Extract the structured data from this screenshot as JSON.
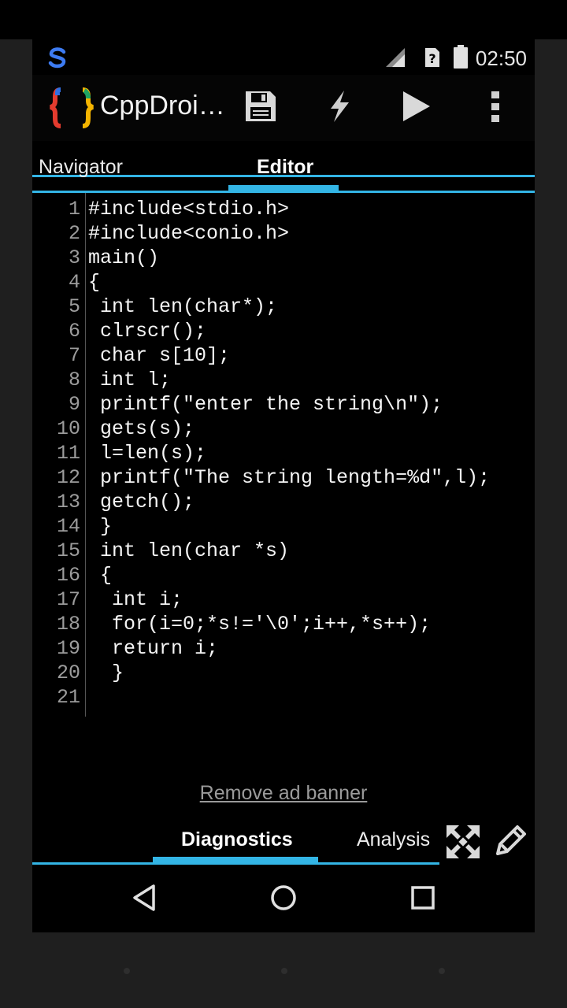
{
  "status_bar": {
    "time": "02:50",
    "app_icon": "sync-s-icon",
    "signal_icon": "cell-signal-icon",
    "sim_icon": "sim-unknown-icon",
    "battery_icon": "battery-icon"
  },
  "action_bar": {
    "title": "CppDroi…",
    "logo_icon": "braces-logo-icon",
    "actions": [
      "save-icon",
      "bolt-icon",
      "play-icon",
      "overflow-menu-icon"
    ]
  },
  "tabs": [
    {
      "label": "Navigator",
      "active": false
    },
    {
      "label": "Editor",
      "active": true
    }
  ],
  "editor": {
    "lines": [
      {
        "num": "1",
        "text": "#include<stdio.h>"
      },
      {
        "num": "2",
        "text": "#include<conio.h>"
      },
      {
        "num": "3",
        "text": "main()"
      },
      {
        "num": "4",
        "text": "{"
      },
      {
        "num": "5",
        "text": " int len(char*);"
      },
      {
        "num": "6",
        "text": " clrscr();"
      },
      {
        "num": "7",
        "text": " char s[10];"
      },
      {
        "num": "8",
        "text": " int l;"
      },
      {
        "num": "9",
        "text": " printf(\"enter the string\\n\");"
      },
      {
        "num": "10",
        "text": " gets(s);"
      },
      {
        "num": "11",
        "text": " l=len(s);"
      },
      {
        "num": "12",
        "text": " printf(\"The string length=%d\",l);"
      },
      {
        "num": "13",
        "text": " getch();"
      },
      {
        "num": "14",
        "text": " }"
      },
      {
        "num": "15",
        "text": " int len(char *s)"
      },
      {
        "num": "16",
        "text": " {"
      },
      {
        "num": "17",
        "text": "  int i;"
      },
      {
        "num": "18",
        "text": "  for(i=0;*s!='\\0';i++,*s++);"
      },
      {
        "num": "19",
        "text": "  return i;"
      },
      {
        "num": "20",
        "text": "  }"
      },
      {
        "num": "21",
        "text": ""
      }
    ]
  },
  "remove_ad_label": "Remove ad banner",
  "bottom_tabs": [
    {
      "label": "Diagnostics",
      "active": true
    },
    {
      "label": "Analysis",
      "active": false
    }
  ],
  "bottom_icons": [
    "expand-icon",
    "pencil-icon"
  ],
  "nav_bar": [
    "back-icon",
    "home-icon",
    "recents-icon"
  ],
  "colors": {
    "accent": "#33b5e5",
    "background": "#000000",
    "bezel": "#1f1f1f",
    "line_number": "#9c9c9c"
  }
}
